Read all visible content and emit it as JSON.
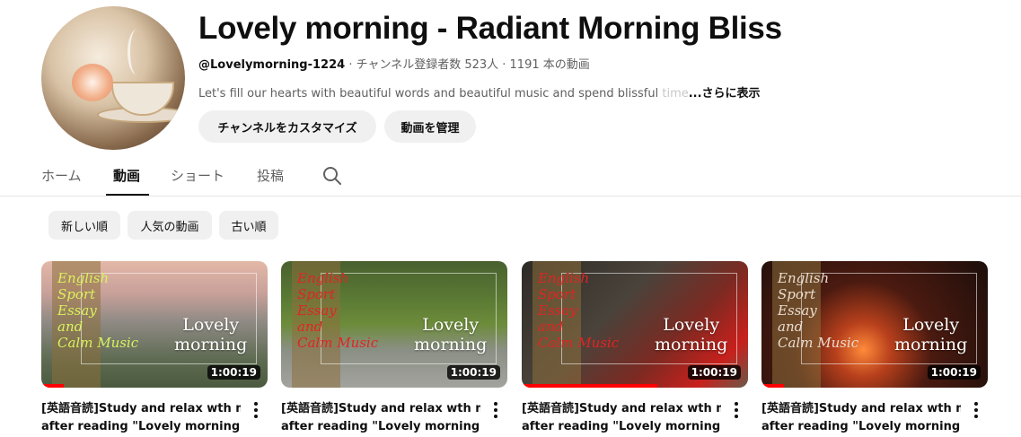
{
  "channel": {
    "title": "Lovely morning - Radiant Morning Bliss",
    "handle": "@Lovelymorning-1224",
    "meta": " · チャンネル登録者数 523人 · 1191 本の動画",
    "description": "Let's fill our hearts with beautiful words and beautiful music and spend blissful ",
    "description_fade": "time",
    "more_label": "...さらに表示"
  },
  "buttons": {
    "customize": "チャンネルをカスタマイズ",
    "manage": "動画を管理"
  },
  "tabs": [
    {
      "label": "ホーム",
      "active": false
    },
    {
      "label": "動画",
      "active": true
    },
    {
      "label": "ショート",
      "active": false
    },
    {
      "label": "投稿",
      "active": false
    }
  ],
  "icons": {
    "tab_search": "search-icon",
    "video_menu": "more-vert-icon"
  },
  "sort_chips": [
    {
      "label": "新しい順",
      "selected": true
    },
    {
      "label": "人気の動画",
      "selected": false
    },
    {
      "label": "古い順",
      "selected": false
    }
  ],
  "colors": {
    "accent": "#ff0000",
    "chip_bg": "#f0f0f0",
    "text_secondary": "#606060"
  },
  "videos": [
    {
      "thumb_text": "English\nSport\nEssay\nand\nCalm Music",
      "thumb_brand": "Lovely\nmorning",
      "duration": "1:00:19",
      "title_line1": "[英語音読]Study and relax wth me",
      "title_line2": "after reading \"Lovely morning\"...",
      "watched": 0.1
    },
    {
      "thumb_text": "English\nSport\nEssay\nand\nCalm Music",
      "thumb_brand": "Lovely\nmorning",
      "duration": "1:00:19",
      "title_line1": "[英語音読]Study and relax wth me",
      "title_line2": "after reading \"Lovely morning\"...",
      "watched": 0
    },
    {
      "thumb_text": "English\nSport\nEssay\nand\nCalm Music",
      "thumb_brand": "Lovely\nmorning",
      "duration": "1:00:19",
      "title_line1": "[英語音読]Study and relax wth me",
      "title_line2": "after reading \"Lovely morning\"...",
      "watched": 0.6
    },
    {
      "thumb_text": "English\nSport\nEssay\nand\nCalm Music",
      "thumb_brand": "Lovely\nmorning",
      "duration": "1:00:19",
      "title_line1": "[英語音読]Study and relax wth me",
      "title_line2": "after reading \"Lovely morning\"...",
      "watched": 0.1
    }
  ]
}
